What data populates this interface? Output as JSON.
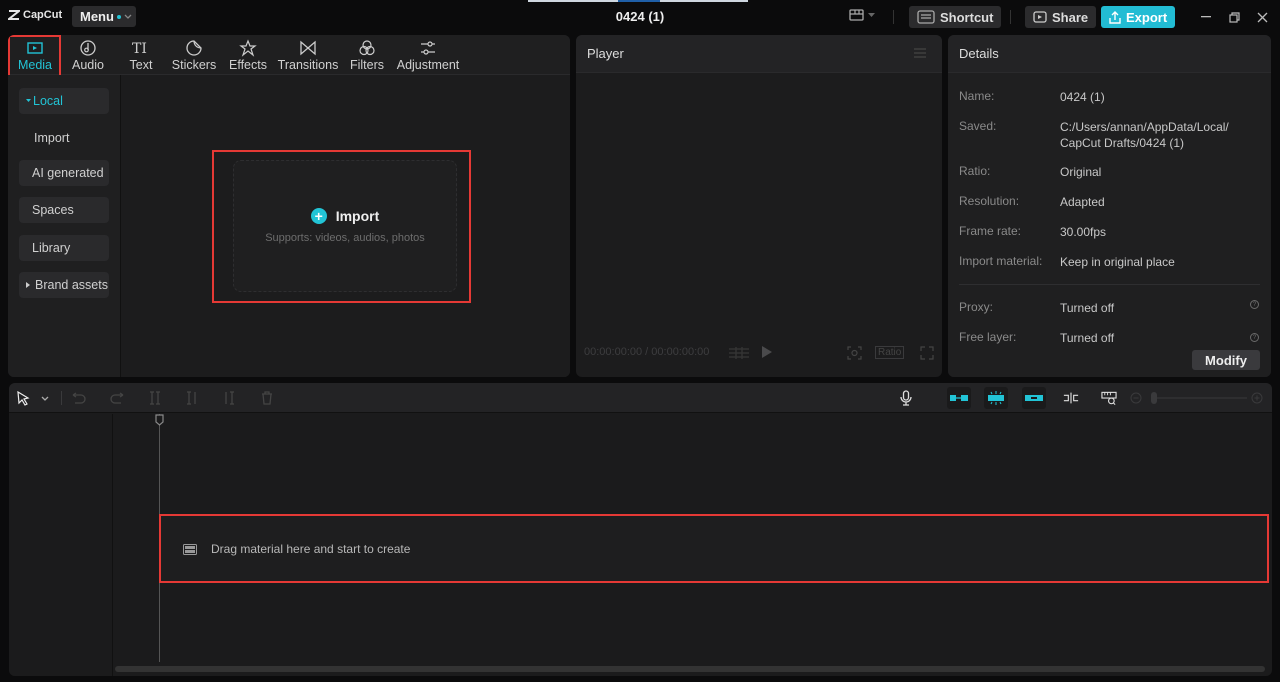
{
  "app": {
    "name": "CapCut",
    "menu_label": "Menu",
    "project_title": "0424 (1)"
  },
  "topbar": {
    "layout_icon": "layout-icon",
    "shortcut_label": "Shortcut",
    "share_label": "Share",
    "export_label": "Export",
    "window_controls": [
      "minimize",
      "restore",
      "close"
    ]
  },
  "tabs": [
    {
      "label": "Media",
      "icon": "media-icon",
      "active": true
    },
    {
      "label": "Audio",
      "icon": "audio-icon"
    },
    {
      "label": "Text",
      "icon": "text-icon"
    },
    {
      "label": "Stickers",
      "icon": "stickers-icon"
    },
    {
      "label": "Effects",
      "icon": "effects-icon"
    },
    {
      "label": "Transitions",
      "icon": "transitions-icon"
    },
    {
      "label": "Filters",
      "icon": "filters-icon"
    },
    {
      "label": "Adjustment",
      "icon": "adjustment-icon"
    }
  ],
  "sidebar": {
    "items": [
      {
        "label": "Local",
        "expanded": true
      },
      {
        "label": "Import"
      },
      {
        "label": "AI generated"
      },
      {
        "label": "Spaces"
      },
      {
        "label": "Library"
      },
      {
        "label": "Brand assets",
        "expandable": true
      }
    ]
  },
  "import_card": {
    "label": "Import",
    "subtitle": "Supports: videos, audios, photos"
  },
  "player": {
    "title": "Player",
    "timecode": "00:00:00:00 / 00:00:00:00",
    "ratio_label": "Ratio"
  },
  "details": {
    "title": "Details",
    "rows": [
      {
        "label": "Name:",
        "value": "0424 (1)"
      },
      {
        "label": "Saved:",
        "value": "C:/Users/annan/AppData/Local/",
        "value2": "CapCut Drafts/0424 (1)"
      },
      {
        "label": "Ratio:",
        "value": "Original"
      },
      {
        "label": "Resolution:",
        "value": "Adapted"
      },
      {
        "label": "Frame rate:",
        "value": "30.00fps"
      },
      {
        "label": "Import material:",
        "value": "Keep in original place"
      },
      {
        "label": "Proxy:",
        "value": "Turned off"
      },
      {
        "label": "Free layer:",
        "value": "Turned off"
      }
    ],
    "modify_label": "Modify"
  },
  "timeline": {
    "drop_hint": "Drag material here and start to create"
  },
  "colors": {
    "accent": "#22c4d6",
    "highlight": "#e53935",
    "background": "#0b0b0c",
    "panel": "#1f1f20"
  }
}
